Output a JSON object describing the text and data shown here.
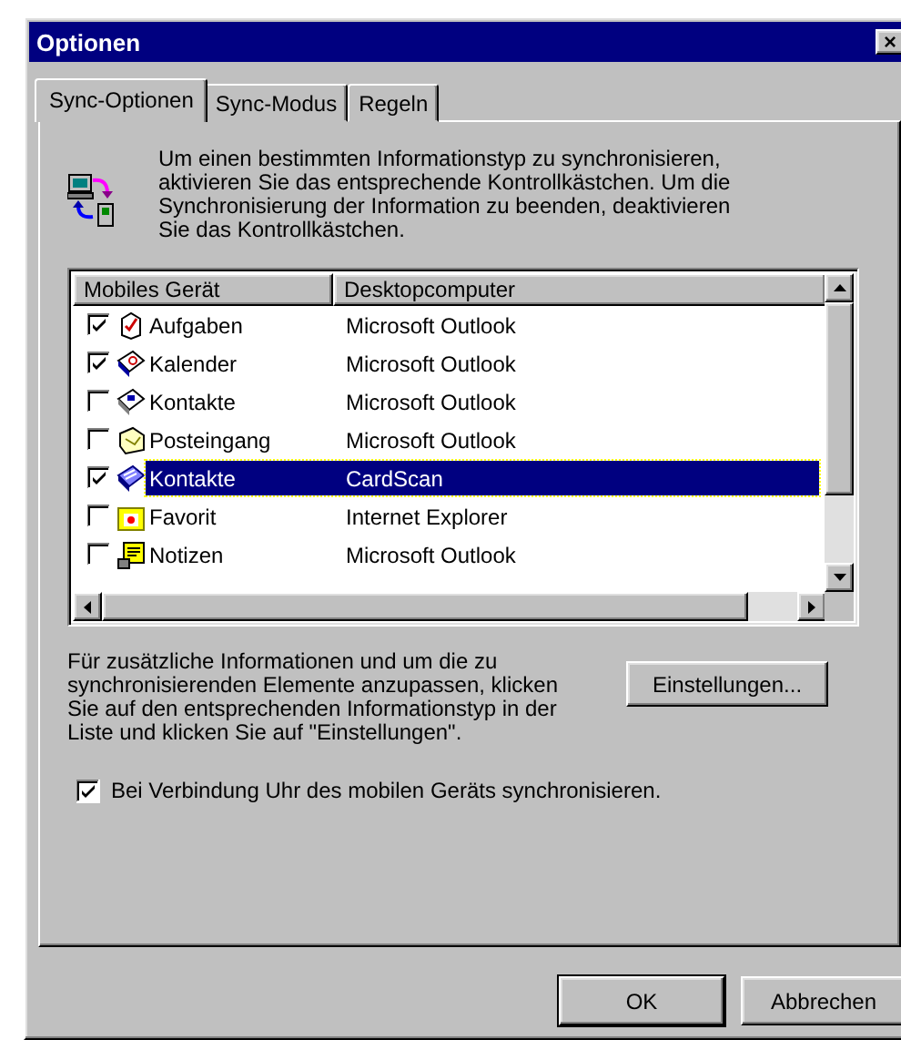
{
  "window": {
    "title": "Optionen",
    "close": "×"
  },
  "tabs": [
    {
      "label": "Sync-Optionen",
      "selected": true
    },
    {
      "label": "Sync-Modus",
      "selected": false
    },
    {
      "label": "Regeln",
      "selected": false
    }
  ],
  "intro": "Um einen bestimmten Informationstyp zu synchronisieren, aktivieren Sie das entsprechende Kontrollkästchen. Um die Synchronisierung der Information zu beenden, deaktivieren Sie das Kontrollkästchen.",
  "list": {
    "columns": [
      "Mobiles Gerät",
      "Desktopcomputer"
    ],
    "rows": [
      {
        "device": "Aufgaben",
        "desktop": "Microsoft Outlook",
        "checked": true,
        "selected": false
      },
      {
        "device": "Kalender",
        "desktop": "Microsoft Outlook",
        "checked": true,
        "selected": false
      },
      {
        "device": "Kontakte",
        "desktop": "Microsoft Outlook",
        "checked": false,
        "selected": false
      },
      {
        "device": "Posteingang",
        "desktop": "Microsoft Outlook",
        "checked": false,
        "selected": false
      },
      {
        "device": "Kontakte",
        "desktop": "CardScan",
        "checked": true,
        "selected": true
      },
      {
        "device": "Favorit",
        "desktop": "Internet Explorer",
        "checked": false,
        "selected": false
      },
      {
        "device": "Notizen",
        "desktop": "Microsoft Outlook",
        "checked": false,
        "selected": false
      }
    ]
  },
  "hint": "Für zusätzliche Informationen und um die zu synchronisierenden Elemente anzupassen, klicken Sie auf den entsprechenden Informationstyp in der Liste und klicken Sie auf \"Einstellungen\".",
  "settings_button": "Einstellungen...",
  "clock_sync": {
    "label": "Bei Verbindung Uhr des mobilen Geräts synchronisieren.",
    "checked": true
  },
  "buttons": [
    {
      "label": "OK",
      "default": true
    },
    {
      "label": "Abbrechen",
      "default": false
    }
  ]
}
